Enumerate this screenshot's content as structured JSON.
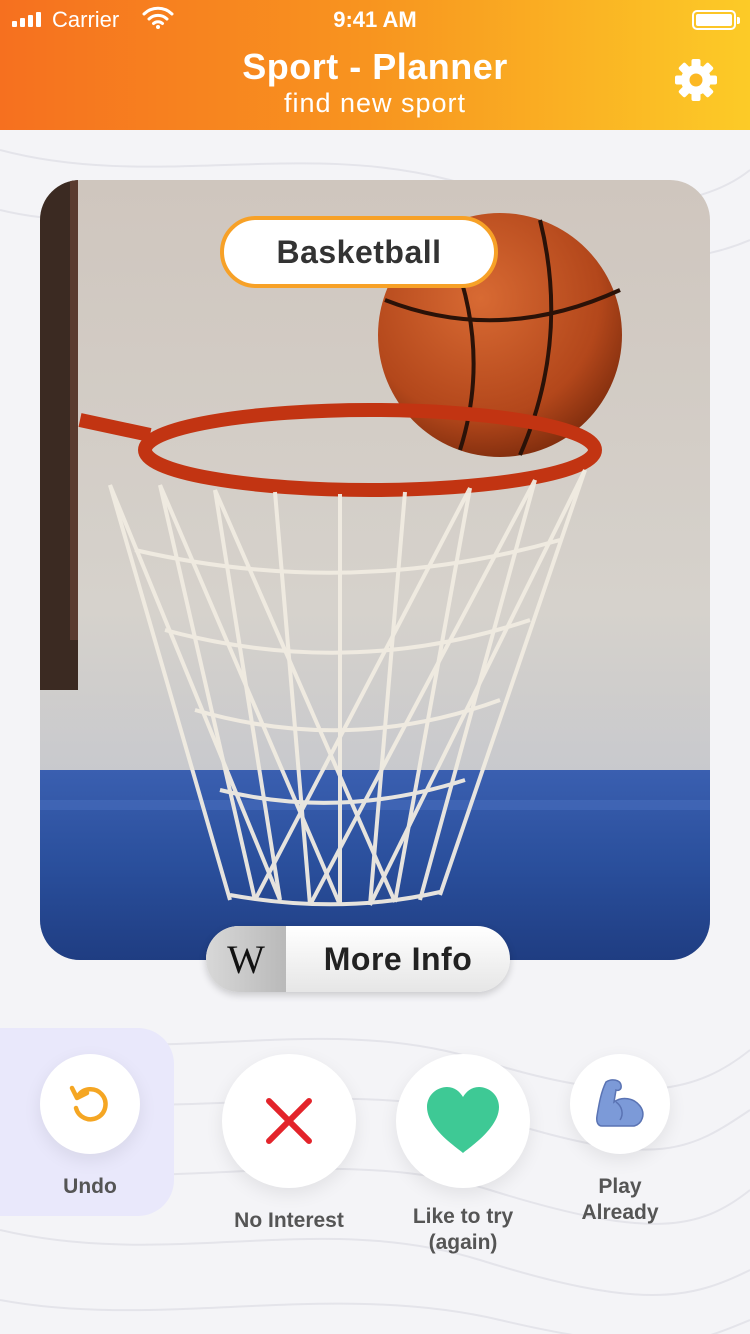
{
  "status_bar": {
    "carrier": "Carrier",
    "time": "9:41 AM"
  },
  "header": {
    "title": "Sport - Planner",
    "subtitle": "find new sport"
  },
  "card": {
    "sport_name": "Basketball",
    "wiki_glyph": "W",
    "more_info_label": "More Info"
  },
  "actions": {
    "undo": "Undo",
    "no_interest": "No Interest",
    "like_line1": "Like to try",
    "like_line2": "(again)",
    "play_line1": "Play",
    "play_line2": "Already"
  },
  "icons": {
    "settings": "gear-icon",
    "undo": "undo-icon",
    "no_interest": "close-icon",
    "like": "heart-icon",
    "play": "flexed-bicep-icon"
  },
  "colors": {
    "header_start": "#f6701f",
    "header_end": "#fccb27",
    "accent_orange": "#f7a127",
    "close_red": "#e3242b",
    "heart_green": "#3ec995",
    "bicep_blue": "#7c9ad8",
    "undo_panel": "#e9e8fb"
  }
}
